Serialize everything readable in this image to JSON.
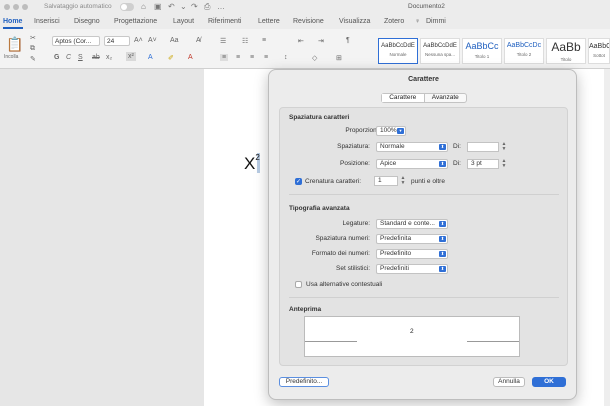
{
  "window": {
    "autosave_label": "Salvataggio automatico",
    "doc_title": "Documento2"
  },
  "menu": {
    "tabs": [
      "Home",
      "Inserisci",
      "Disegno",
      "Progettazione",
      "Layout",
      "Riferimenti",
      "Lettere",
      "Revisione",
      "Visualizza",
      "Zotero"
    ],
    "tell_me": "Dimmi"
  },
  "ribbon": {
    "paste_label": "Incolla",
    "font_name": "Aptos (Cor...",
    "font_size": "24",
    "styles": [
      {
        "preview": "AaBbCcDdE",
        "name": "Normale"
      },
      {
        "preview": "AaBbCcDdE",
        "name": "Nessuna spa..."
      },
      {
        "preview": "AaBbCc",
        "name": "Titolo 1"
      },
      {
        "preview": "AaBbCcDc",
        "name": "Titolo 2"
      },
      {
        "preview": "AaBb",
        "name": "Titolo"
      },
      {
        "preview": "AaBbC",
        "name": "Sottot"
      }
    ]
  },
  "document": {
    "text": "X",
    "superscript": "2"
  },
  "dialog": {
    "title": "Carattere",
    "tabs": [
      "Carattere",
      "Avanzate"
    ],
    "spacing_header": "Spaziatura caratteri",
    "scale_label": "Proporzioni:",
    "scale_value": "100%",
    "spacing_label": "Spaziatura:",
    "spacing_value": "Normale",
    "position_label": "Posizione:",
    "position_value": "Apice",
    "by_label": "Di:",
    "spacing_by": "",
    "position_by": "3 pt",
    "kerning_label": "Crenatura caratteri:",
    "kerning_value": "1",
    "kerning_unit": "punti e oltre",
    "typo_header": "Tipografia avanzata",
    "ligatures_label": "Legature:",
    "ligatures_value": "Standard e conte...",
    "numspacing_label": "Spaziatura numeri:",
    "numspacing_value": "Predefinita",
    "numform_label": "Formato dei numeri:",
    "numform_value": "Predefinito",
    "stylistic_label": "Set stilistici:",
    "stylistic_value": "Predefiniti",
    "contextual_label": "Usa alternative contestuali",
    "preview_header": "Anteprima",
    "preview_text": "2",
    "default_button": "Predefinito...",
    "cancel_button": "Annulla",
    "ok_button": "OK"
  }
}
